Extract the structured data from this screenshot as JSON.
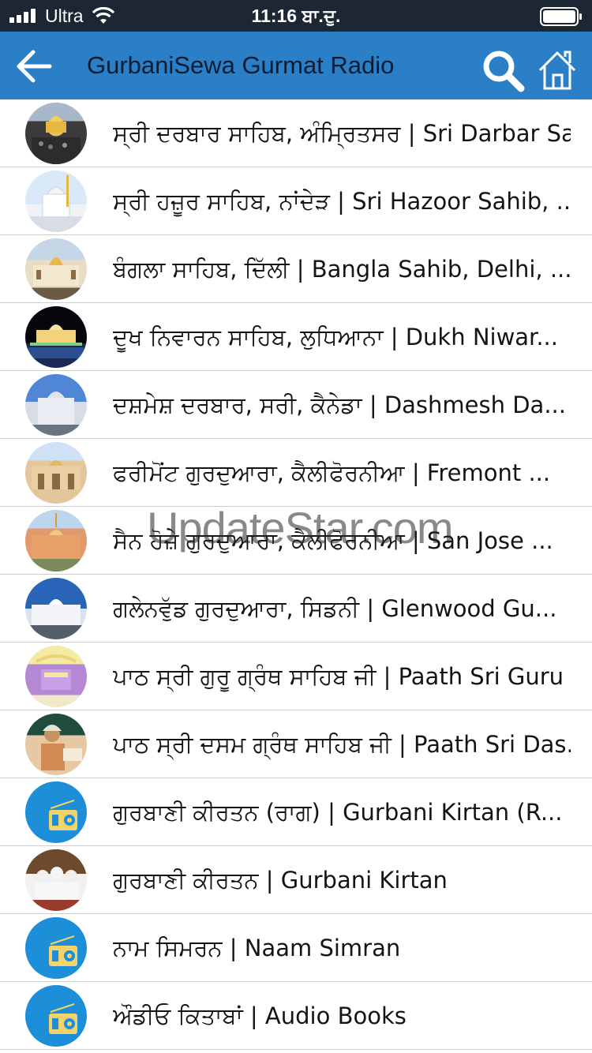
{
  "status_bar": {
    "carrier": "Ultra",
    "time": "11:16 ਬਾ.ਦੁ."
  },
  "nav": {
    "title": "GurbaniSewa Gurmat Radio",
    "icons": [
      "back-arrow-icon",
      "search-icon",
      "home-icon"
    ],
    "bar_color": "#2a7fc6"
  },
  "stations": [
    {
      "label": "ਸ੍ਰੀ ਦਰਬਾਰ ਸਾਹਿਬ, ਅੰਮ੍ਰਿਤਸਰ | Sri Darbar Sa...",
      "avatar": "golden-temple-photo"
    },
    {
      "label": "ਸ੍ਰੀ ਹਜ਼ੂਰ ਸਾਹਿਬ, ਨਾਂਦੇੜ | Sri Hazoor Sahib, ...",
      "avatar": "hazoor-sahib-photo"
    },
    {
      "label": "ਬੰਗਲਾ ਸਾਹਿਬ, ਦਿੱਲੀ | Bangla Sahib, Delhi, ...",
      "avatar": "bangla-sahib-photo"
    },
    {
      "label": "ਦੂਖ ਨਿਵਾਰਨ ਸਾਹਿਬ, ਲੁਧਿਆਨਾ | Dukh Niwar...",
      "avatar": "dukh-niwaran-photo"
    },
    {
      "label": "ਦਸ਼ਮੇਸ਼ ਦਰਬਾਰ, ਸਰੀ, ਕੈਨੇਡਾ | Dashmesh Da...",
      "avatar": "dashmesh-darbar-photo"
    },
    {
      "label": "ਫਰੀਮੋਂਟ ਗੁਰਦੁਆਰਾ, ਕੈਲੀਫੋਰਨੀਆ | Fremont ...",
      "avatar": "fremont-gurdwara-photo"
    },
    {
      "label": "ਸੈਨ ਹੋਜ਼ੇ ਗੁਰਦੁਆਰਾ, ਕੈਲੀਫੋਰਨੀਆ | San Jose ...",
      "avatar": "san-jose-gurdwara-photo"
    },
    {
      "label": "ਗਲੇਨਵੁੱਡ ਗੁਰਦੁਆਰਾ, ਸਿਡਨੀ | Glenwood Gu...",
      "avatar": "glenwood-gurdwara-photo"
    },
    {
      "label": "ਪਾਠ ਸ੍ਰੀ ਗੁਰੂ ਗ੍ਰੰਥ ਸਾਹਿਬ ਜੀ | Paath Sri Guru ...",
      "avatar": "guru-granth-sahib-photo"
    },
    {
      "label": "ਪਾਠ ਸ੍ਰੀ ਦਸਮ ਗ੍ਰੰਥ ਸਾਹਿਬ ਜੀ | Paath Sri Das...",
      "avatar": "dasam-granth-photo"
    },
    {
      "label": "ਗੁਰਬਾਣੀ ਕੀਰਤਨ (ਰਾਗ) | Gurbani Kirtan (R...",
      "avatar": "radio-icon"
    },
    {
      "label": "ਗੁਰਬਾਣੀ ਕੀਰਤਨ | Gurbani Kirtan",
      "avatar": "kirtan-photo"
    },
    {
      "label": "ਨਾਮ ਸਿਮਰਨ | Naam Simran",
      "avatar": "radio-icon"
    },
    {
      "label": "ਔਡੀਓ ਕਿਤਾਬਾਂ | Audio Books",
      "avatar": "radio-icon"
    }
  ],
  "watermark": "UpdateStar.com"
}
